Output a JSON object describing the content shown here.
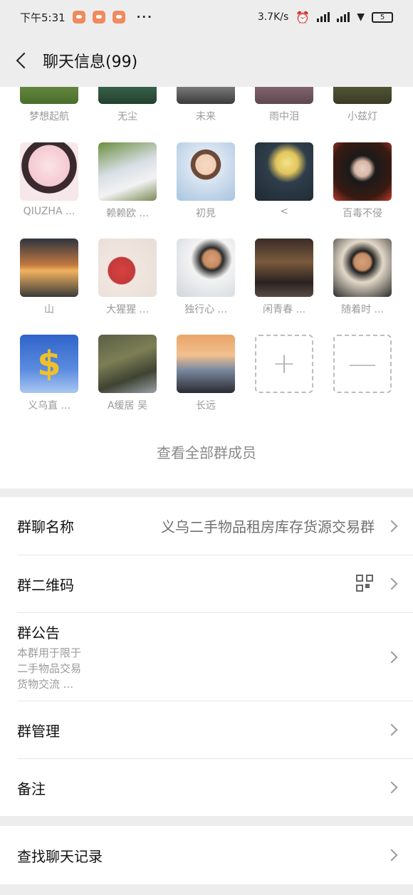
{
  "status_bar": {
    "time": "下午5:31",
    "more": "···",
    "speed": "3.7K/s",
    "battery": "5"
  },
  "nav": {
    "title": "聊天信息(99)"
  },
  "members_top_row": [
    "梦想起航",
    "无尘",
    "未来",
    "雨中泪",
    "小兹灯"
  ],
  "members": [
    {
      "name": "QIUZHA ..."
    },
    {
      "name": "赖赖欧 ..."
    },
    {
      "name": "初見"
    },
    {
      "name": "<"
    },
    {
      "name": "百毒不侵"
    },
    {
      "name": "山"
    },
    {
      "name": "大猩猩 ..."
    },
    {
      "name": "独行心 ..."
    },
    {
      "name": "闲青春 ..."
    },
    {
      "name": "随着时 ..."
    },
    {
      "name": "义乌直 ..."
    },
    {
      "name": "A缓居 吴"
    },
    {
      "name": "长远"
    }
  ],
  "add_label": "+",
  "remove_label": "—",
  "view_all": "查看全部群成员",
  "settings": {
    "group_name_label": "群聊名称",
    "group_name_value": "义乌二手物品租房库存货源交易群",
    "qr_label": "群二维码",
    "notice_label": "群公告",
    "notice_line1": "本群用于限于",
    "notice_line2": "二手物品交易",
    "notice_line3": "货物交流 ...",
    "manage_label": "群管理",
    "remark_label": "备注"
  },
  "search_history": "查找聊天记录",
  "colors": {
    "background": "#ededed",
    "card": "#ffffff",
    "muted_text": "#9a9a9a"
  }
}
